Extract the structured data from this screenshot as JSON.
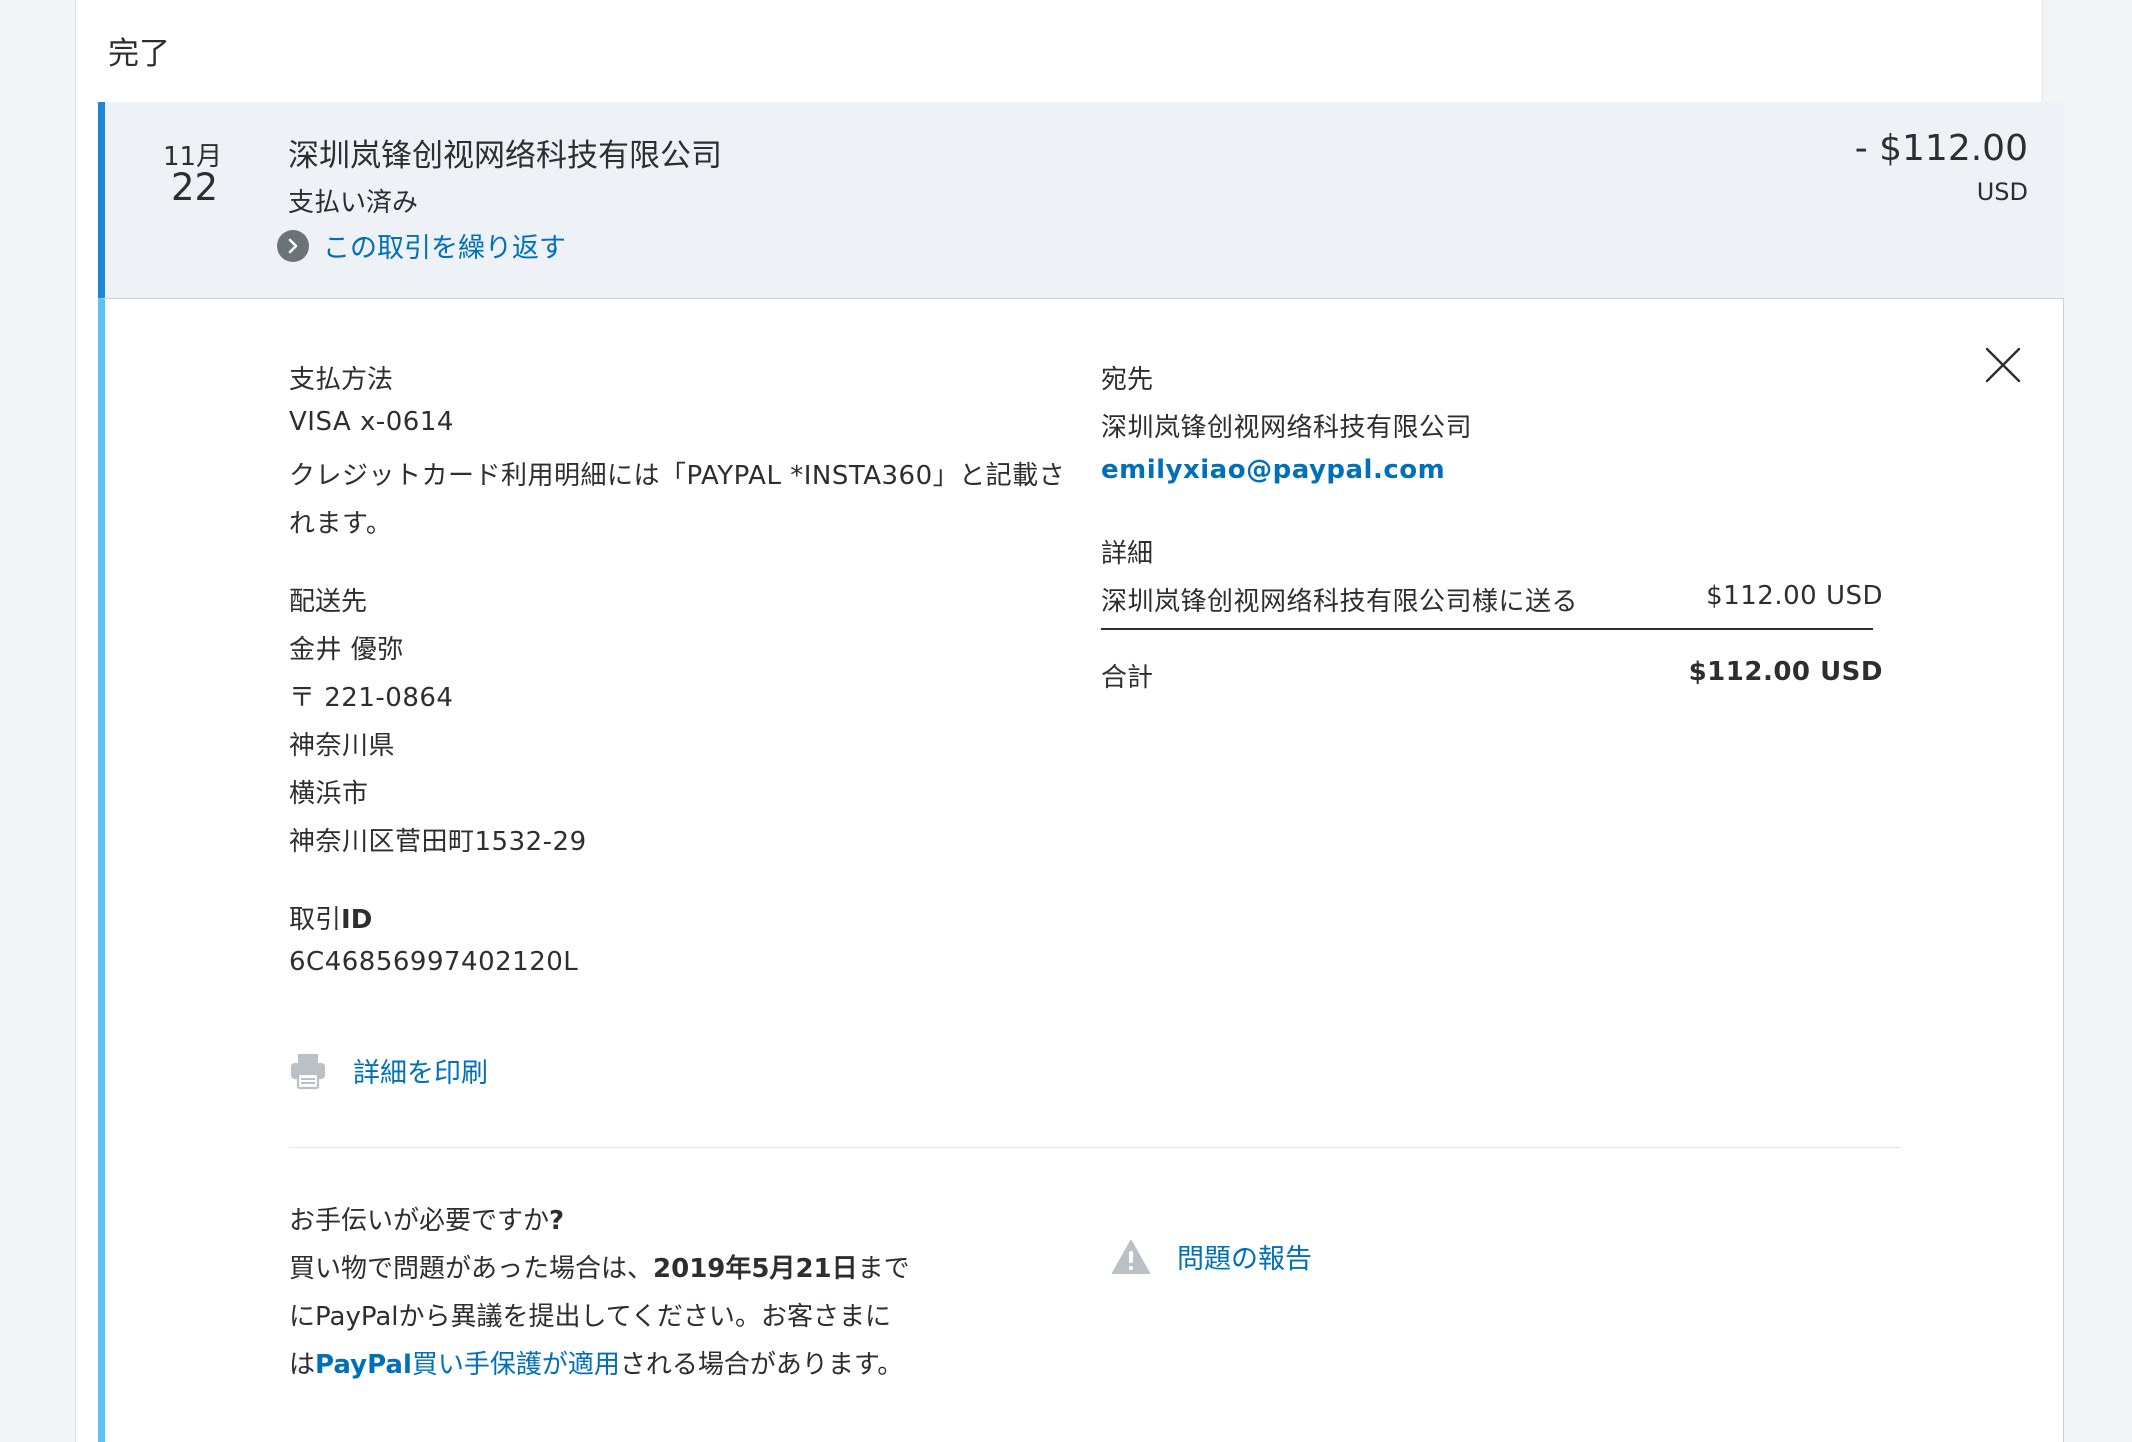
{
  "section_title": "完了",
  "transaction": {
    "month": "11月",
    "day": "22",
    "merchant": "深圳岚锋创视网络科技有限公司",
    "status": "支払い済み",
    "repeat_label": "この取引を繰り返す",
    "amount": "- $112.00",
    "currency": "USD"
  },
  "details": {
    "payment_method_label": "支払方法",
    "card": "VISA x-0614",
    "statement_note_line1": "クレジットカード利用明細には「PAYPAL *INSTA360」と記載さ",
    "statement_note_line2": "れます。",
    "shipping_label": "配送先",
    "shipping_name": "金井 優弥",
    "shipping_postal": "〒 221-0864",
    "shipping_prefecture": "神奈川県",
    "shipping_city": "横浜市",
    "shipping_street": "神奈川区菅田町1532-29",
    "txid_label_prefix": "取引",
    "txid_label_suffix": "ID",
    "txid_value": "6C46856997402120L",
    "recipient_label": "宛先",
    "recipient_name": "深圳岚锋创视网络科技有限公司",
    "recipient_email": "emilyxiao@paypal.com",
    "breakdown_label": "詳細",
    "breakdown_item": "深圳岚锋创视网络科技有限公司様に送る",
    "breakdown_item_amount": "$112.00 USD",
    "total_label": "合計",
    "total_amount": "$112.00 USD",
    "print_label": "詳細を印刷"
  },
  "help": {
    "title_prefix": "お手伝いが必要ですか",
    "title_q": "?",
    "line1_prefix": "買い物で問題があった場合は、",
    "deadline": "2019年5月21日",
    "line1_suffix": "まで",
    "line2": "にPayPalから異議を提出してください。お客さまに",
    "line3_prefix": "は",
    "protection_brand": "PayPal",
    "protection_link": "買い手保護が適用",
    "line3_suffix": "される場合があります。",
    "report_label": "問題の報告"
  },
  "colors": {
    "accent_summary": "#1e88d8",
    "accent_details": "#5ac3f0",
    "link": "#0070ba",
    "summary_bg": "#eef1f6"
  },
  "icons": [
    "chevron-right-icon",
    "close-icon",
    "printer-icon",
    "warning-icon"
  ]
}
